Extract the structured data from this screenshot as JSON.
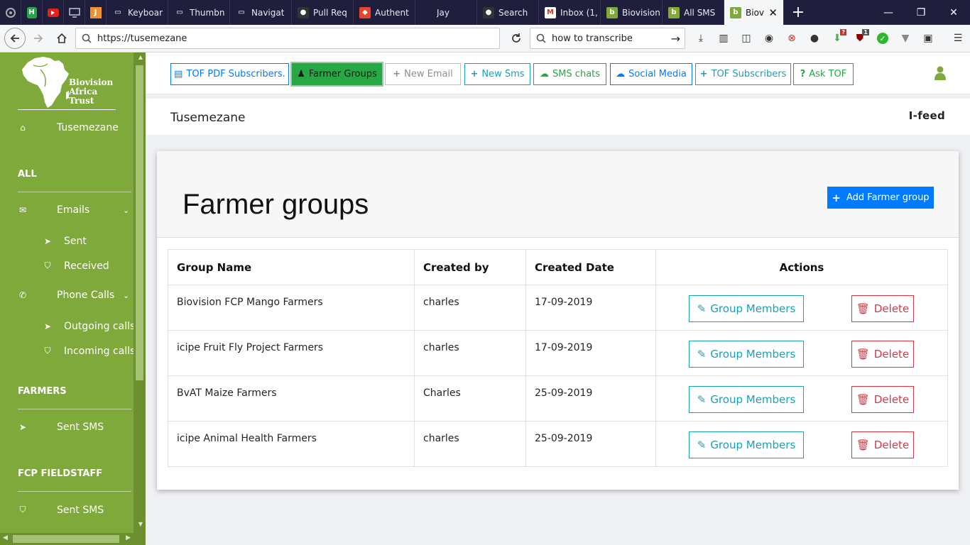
{
  "browser": {
    "tabs": [
      {
        "title": "Keyboar",
        "icon": "monitor-icon"
      },
      {
        "title": "Thumbn",
        "icon": "monitor-icon"
      },
      {
        "title": "Navigat",
        "icon": "monitor-icon"
      },
      {
        "title": "Pull Req",
        "icon": "github-icon"
      },
      {
        "title": "Authent",
        "icon": "laravel-icon"
      },
      {
        "title": "Jay",
        "icon": "blank-icon"
      },
      {
        "title": "Search",
        "icon": "github-icon"
      },
      {
        "title": "Inbox (1,",
        "icon": "gmail-icon"
      },
      {
        "title": "Biovision",
        "icon": "biovision-icon"
      },
      {
        "title": "All SMS",
        "icon": "biovision-icon"
      }
    ],
    "active_tab": {
      "title": "Biovi",
      "icon": "biovision-icon"
    },
    "url": "https://tusemezane",
    "search_value": "how to transcribe",
    "badges": {
      "ext1": "?",
      "ext2": "1"
    }
  },
  "sidebar": {
    "logo_text": [
      "Biovision",
      "Africa",
      "Trust"
    ],
    "home_label": "Tusemezane",
    "sections": {
      "all": "ALL",
      "farmers": "FARMERS",
      "fcp": "FCP FIELDSTAFF"
    },
    "items": {
      "emails": "Emails",
      "sent": "Sent",
      "received": "Received",
      "phone_calls": "Phone Calls",
      "outgoing": "Outgoing calls",
      "incoming": "Incoming calls",
      "farmers_sent_sms": "Sent SMS",
      "fcp_sent_sms": "Sent SMS"
    }
  },
  "topbar": {
    "buttons": [
      {
        "label": "TOF PDF Subscribers.",
        "icon": "pdf-icon"
      },
      {
        "label": "Farmer Groups",
        "icon": "person-icon"
      },
      {
        "label": "New Email",
        "icon": "plus-icon"
      },
      {
        "label": "New Sms",
        "icon": "plus-icon"
      },
      {
        "label": "SMS chats",
        "icon": "chat-icon"
      },
      {
        "label": "Social Media",
        "icon": "chat-icon"
      },
      {
        "label": "TOF Subscribers",
        "icon": "plus-icon"
      },
      {
        "label": "Ask TOF",
        "icon": "question-icon"
      }
    ]
  },
  "subheader": {
    "title": "Tusemezane",
    "brand": "I-feed"
  },
  "page": {
    "heading": "Farmer groups",
    "add_button": "Add Farmer group"
  },
  "table": {
    "headers": [
      "Group Name",
      "Created by",
      "Created Date",
      "Actions"
    ],
    "rows": [
      {
        "name": "Biovision FCP Mango Farmers",
        "created_by": "charles",
        "date": "17-09-2019"
      },
      {
        "name": "icipe Fruit Fly Project Farmers",
        "created_by": "charles",
        "date": "17-09-2019"
      },
      {
        "name": "BvAT Maize Farmers",
        "created_by": "Charles",
        "date": "25-09-2019"
      },
      {
        "name": "icipe Animal Health Farmers",
        "created_by": "charles",
        "date": "25-09-2019"
      }
    ],
    "members_label": "Group Members",
    "delete_label": "Delete"
  },
  "colors": {
    "sidebar": "#80a93c",
    "primary": "#007bff",
    "success": "#28a745",
    "info": "#17a2b8",
    "danger": "#dc3545"
  }
}
